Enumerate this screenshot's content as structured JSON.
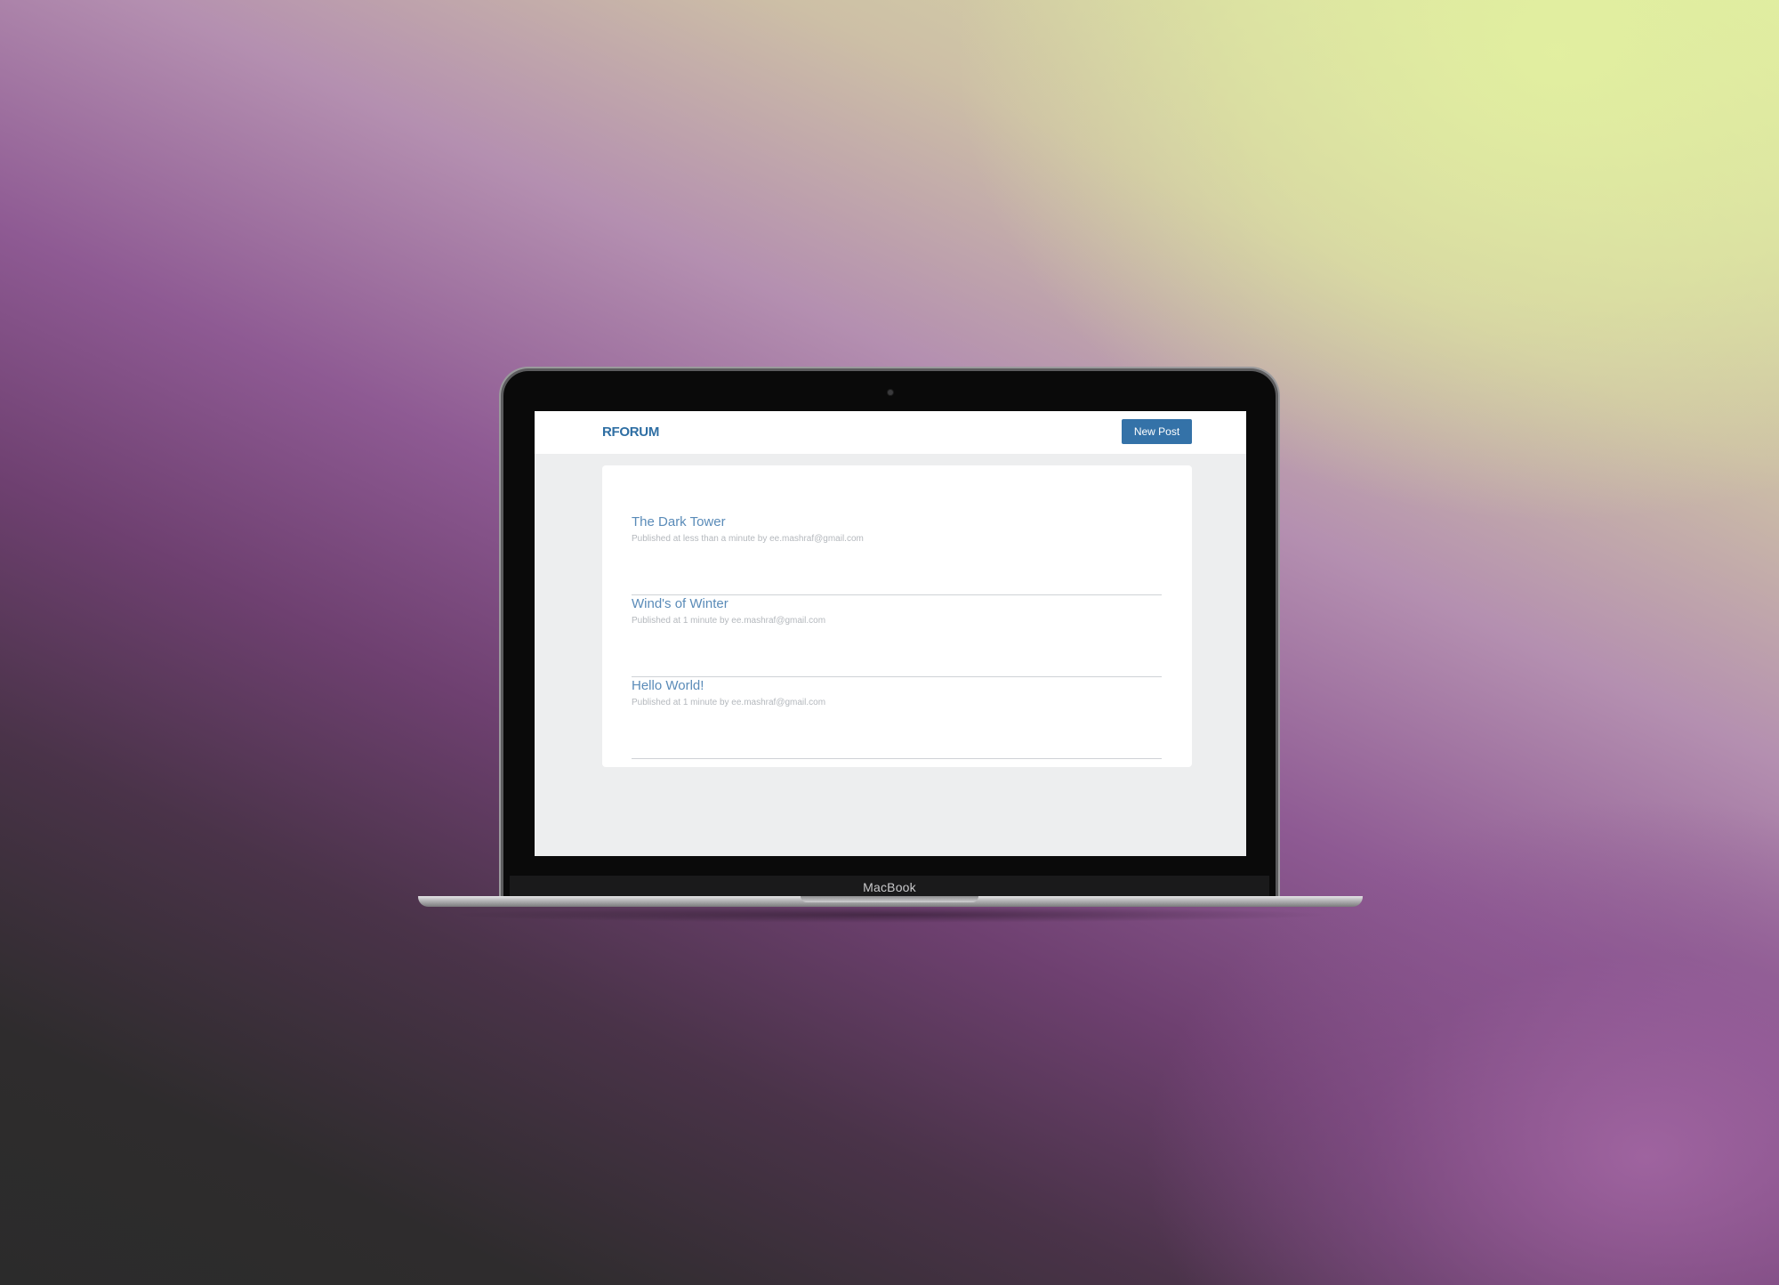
{
  "device": {
    "label": "MacBook"
  },
  "app": {
    "brand": "RFORUM",
    "new_post_label": "New Post"
  },
  "posts": [
    {
      "title": "The Dark Tower",
      "meta": "Published at less than a minute by ee.mashraf@gmail.com"
    },
    {
      "title": "Wind's of Winter",
      "meta": "Published at 1 minute by ee.mashraf@gmail.com"
    },
    {
      "title": "Hello World!",
      "meta": "Published at 1 minute by ee.mashraf@gmail.com"
    }
  ],
  "colors": {
    "brand": "#2e6ea3",
    "button": "#3472a8",
    "post_title": "#5a8bb8",
    "page_bg": "#edeeef"
  }
}
